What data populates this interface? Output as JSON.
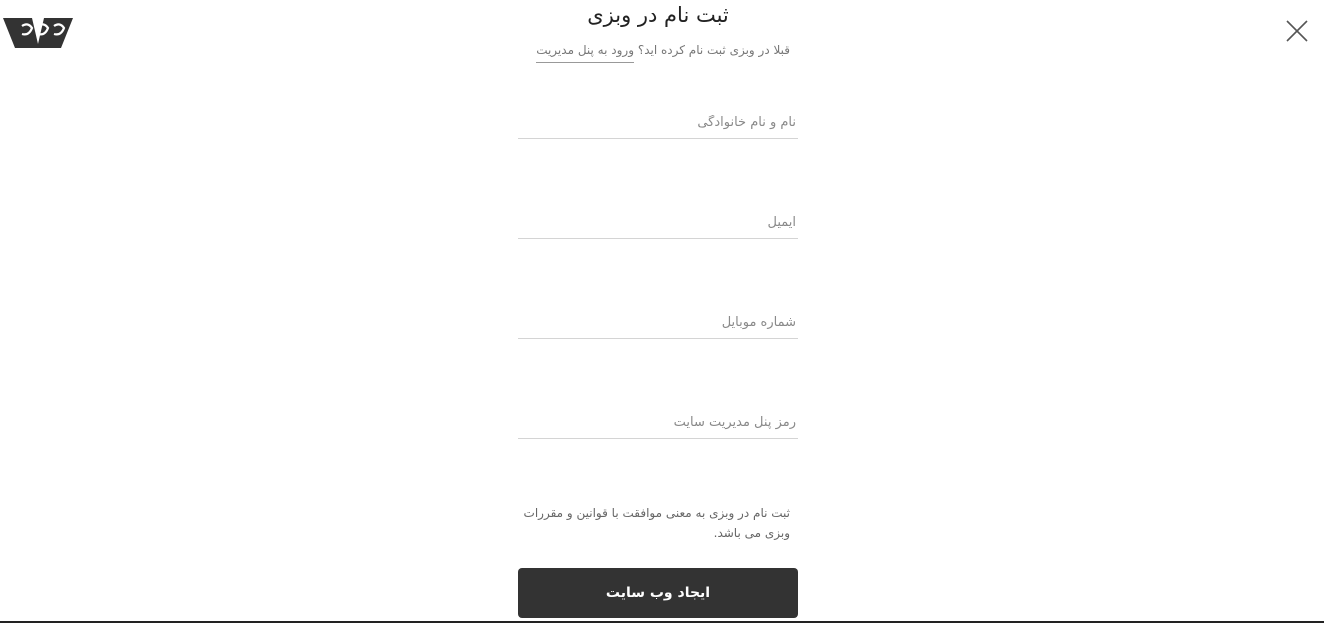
{
  "header": {
    "title": "ثبت نام در وبزی",
    "subtitle_prefix": "قبلا در وبزی ثبت نام کرده اید؟",
    "login_link": "ورود به پنل مدیریت",
    "logo_icon": "webzi-logo",
    "close_icon": "close-icon"
  },
  "form": {
    "name_placeholder": "نام و نام خانوادگی",
    "email_placeholder": "ایمیل",
    "mobile_placeholder": "شماره موبایل",
    "password_placeholder": "رمز پنل مدیریت سایت",
    "terms_text": "ثبت نام در وبزی به معنی موافقت با قوانین و مقررات وبزی می باشد.",
    "submit_label": "ایجاد وب سایت"
  },
  "colors": {
    "button_bg": "#333333",
    "button_text": "#ffffff",
    "field_border": "#d4d4d4",
    "placeholder": "#8a8a8a"
  }
}
